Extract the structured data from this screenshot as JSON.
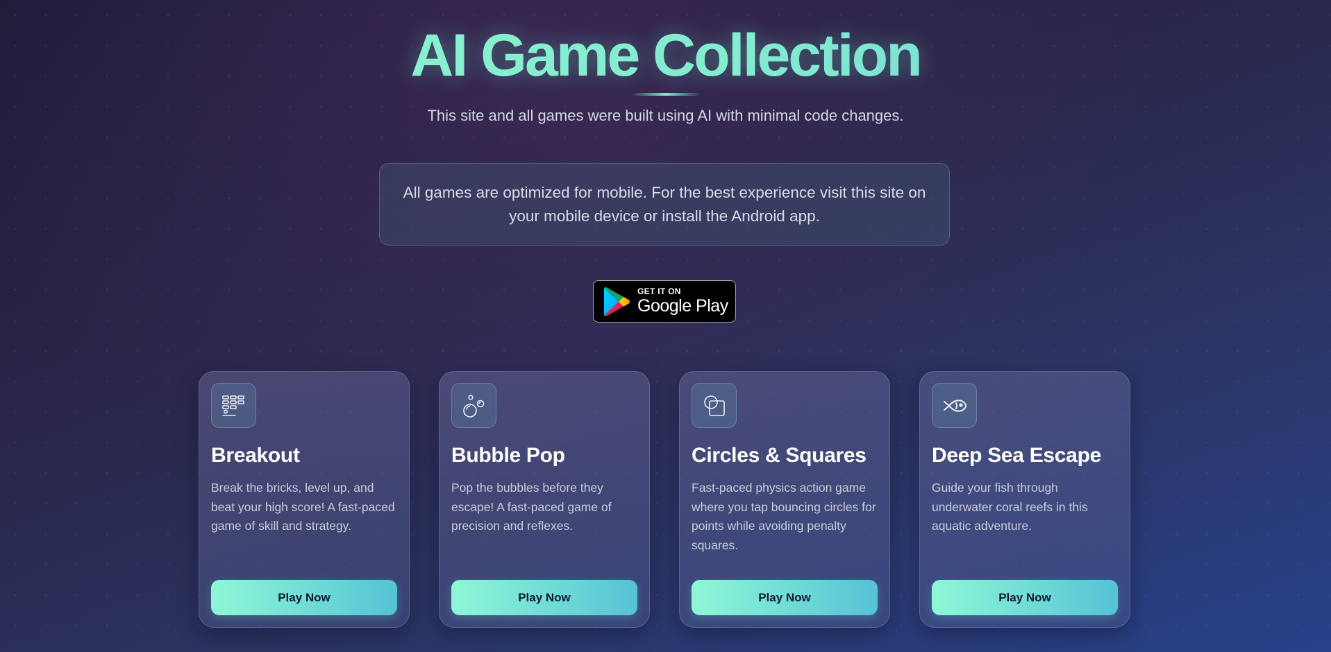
{
  "header": {
    "title": "AI Game Collection",
    "subtitle": "This site and all games were built using AI with minimal code changes."
  },
  "notice": {
    "text": "All games are optimized for mobile. For the best experience visit this site on your mobile device or install the Android app."
  },
  "google_play": {
    "small_text": "GET IT ON",
    "big_text": "Google Play"
  },
  "games": [
    {
      "title": "Breakout",
      "description": "Break the bricks, level up, and beat your high score! A fast-paced game of skill and strategy.",
      "button": "Play Now",
      "icon": "breakout-icon"
    },
    {
      "title": "Bubble Pop",
      "description": "Pop the bubbles before they escape! A fast-paced game of precision and reflexes.",
      "button": "Play Now",
      "icon": "bubbles-icon"
    },
    {
      "title": "Circles & Squares",
      "description": "Fast-paced physics action game where you tap bouncing circles for points while avoiding penalty squares.",
      "button": "Play Now",
      "icon": "circle-square-icon"
    },
    {
      "title": "Deep Sea Escape",
      "description": "Guide your fish through underwater coral reefs in this aquatic adventure.",
      "button": "Play Now",
      "icon": "fish-icon"
    }
  ],
  "colors": {
    "accent": "#8ff5d2",
    "accent_end": "#55c2d6",
    "background_start": "#1c1a36",
    "background_end": "#27428a"
  }
}
